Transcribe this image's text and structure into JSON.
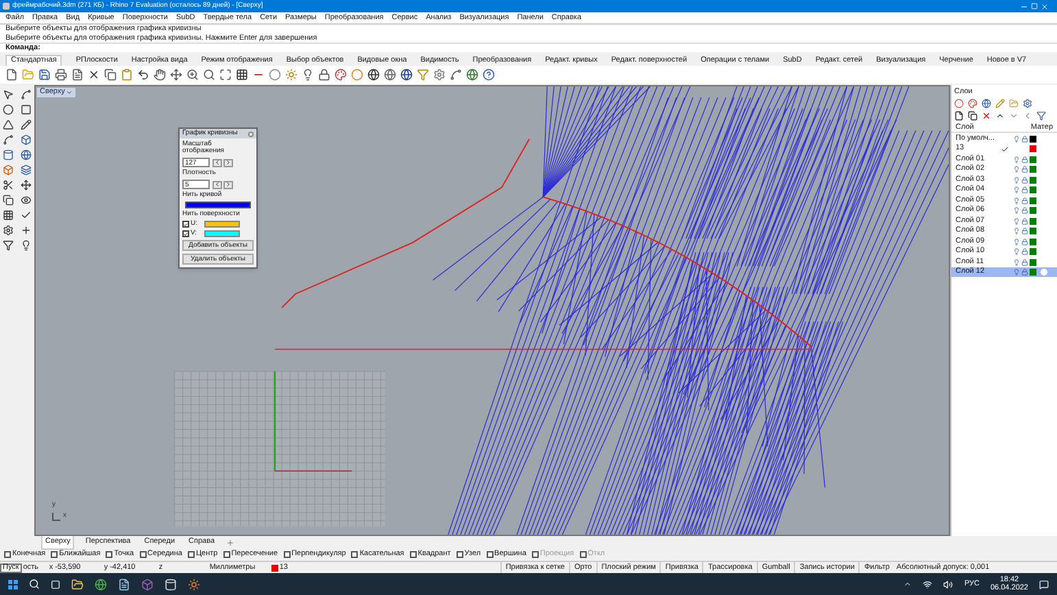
{
  "window": {
    "title": "фреймрабочий.3dm (271 КБ) - Rhino 7 Evaluation (осталось 89 дней) - [Сверху]"
  },
  "menu": [
    "Файл",
    "Правка",
    "Вид",
    "Кривые",
    "Поверхности",
    "SubD",
    "Твердые тела",
    "Сети",
    "Размеры",
    "Преобразования",
    "Сервис",
    "Анализ",
    "Визуализация",
    "Панели",
    "Справка"
  ],
  "command_history": [
    "Выберите объекты для отображения графика кривизны",
    "Выберите объекты для отображения графика кривизны. Нажмите Enter для завершения"
  ],
  "command_prompt": "Команда:",
  "toolbar_tabs": [
    {
      "label": "Стандартная",
      "selected": true
    },
    {
      "label": "РПлоскости",
      "selected": false
    },
    {
      "label": "Настройка вида",
      "selected": false
    },
    {
      "label": "Режим отображения",
      "selected": false
    },
    {
      "label": "Выбор объектов",
      "selected": false
    },
    {
      "label": "Видовые окна",
      "selected": false
    },
    {
      "label": "Видимость",
      "selected": false
    },
    {
      "label": "Преобразования",
      "selected": false
    },
    {
      "label": "Редакт. кривых",
      "selected": false
    },
    {
      "label": "Редакт. поверхностей",
      "selected": false
    },
    {
      "label": "Операции с телами",
      "selected": false
    },
    {
      "label": "SubD",
      "selected": false
    },
    {
      "label": "Редакт. сетей",
      "selected": false
    },
    {
      "label": "Визуализация",
      "selected": false
    },
    {
      "label": "Черчение",
      "selected": false
    },
    {
      "label": "Новое в V7",
      "selected": false
    }
  ],
  "viewport": {
    "title": "Сверху",
    "axis_labels": [
      "y",
      "x"
    ]
  },
  "curvature_dialog": {
    "title": "График кривизны",
    "scale_label": "Масштаб отображения",
    "scale_value": "127",
    "density_label": "Плотность",
    "density_value": "5",
    "curve_hair_label": "Нить кривой",
    "surface_hair_label": "Нить поверхности",
    "surface_hairs": [
      {
        "label": "U:",
        "checked": true,
        "color": "#ffc000"
      },
      {
        "label": "V:",
        "checked": true,
        "color": "#00ffff"
      }
    ],
    "buttons": [
      "Добавить объекты",
      "Удалить объекты"
    ]
  },
  "layers_panel": {
    "title": "Слои",
    "columns": [
      "Слой",
      "Матер"
    ],
    "layers": [
      {
        "name": "По умолч...",
        "current": false,
        "selected": false,
        "color": "#000000"
      },
      {
        "name": "13",
        "current": true,
        "selected": false,
        "color": "#e00000"
      },
      {
        "name": "Слой 01",
        "current": false,
        "selected": false,
        "color": "#008000"
      },
      {
        "name": "Слой 02",
        "current": false,
        "selected": false,
        "color": "#008000"
      },
      {
        "name": "Слой 03",
        "current": false,
        "selected": false,
        "color": "#008000"
      },
      {
        "name": "Слой 04",
        "current": false,
        "selected": false,
        "color": "#008000"
      },
      {
        "name": "Слой 05",
        "current": false,
        "selected": false,
        "color": "#008000"
      },
      {
        "name": "Слой 06",
        "current": false,
        "selected": false,
        "color": "#008000"
      },
      {
        "name": "Слой 07",
        "current": false,
        "selected": false,
        "color": "#008000"
      },
      {
        "name": "Слой 08",
        "current": false,
        "selected": false,
        "color": "#008000"
      },
      {
        "name": "Слой 09",
        "current": false,
        "selected": false,
        "color": "#008000"
      },
      {
        "name": "Слой 10",
        "current": false,
        "selected": false,
        "color": "#008000"
      },
      {
        "name": "Слой 11",
        "current": false,
        "selected": false,
        "color": "#008000"
      },
      {
        "name": "Слой 12",
        "current": false,
        "selected": true,
        "color": "#008000"
      }
    ]
  },
  "viewport_tabs": [
    {
      "label": "Сверху",
      "selected": true
    },
    {
      "label": "Перспектива",
      "selected": false
    },
    {
      "label": "Спереди",
      "selected": false
    },
    {
      "label": "Справа",
      "selected": false
    }
  ],
  "osnaps": [
    {
      "label": "Конечная",
      "checked": false,
      "disabled": false
    },
    {
      "label": "Ближайшая",
      "checked": false,
      "disabled": false
    },
    {
      "label": "Точка",
      "checked": false,
      "disabled": false
    },
    {
      "label": "Середина",
      "checked": false,
      "disabled": false
    },
    {
      "label": "Центр",
      "checked": false,
      "disabled": false
    },
    {
      "label": "Пересечение",
      "checked": false,
      "disabled": false
    },
    {
      "label": "Перпендикуляр",
      "checked": false,
      "disabled": false
    },
    {
      "label": "Касательная",
      "checked": false,
      "disabled": false
    },
    {
      "label": "Квадрант",
      "checked": false,
      "disabled": false
    },
    {
      "label": "Узел",
      "checked": false,
      "disabled": false
    },
    {
      "label": "Вершина",
      "checked": false,
      "disabled": false
    },
    {
      "label": "Проекция",
      "checked": false,
      "disabled": true
    },
    {
      "label": "Откл",
      "checked": false,
      "disabled": true
    }
  ],
  "status_bar": {
    "tooltip": "Пуск",
    "cplane": "ость",
    "x": "x -53,590",
    "y": "y -42,410",
    "z": "z",
    "units": "Миллиметры",
    "layer": "13",
    "toggles": [
      "Привязка к сетке",
      "Орто",
      "Плоский режим",
      "Привязка",
      "Трассировка",
      "Gumball",
      "Запись истории",
      "Фильтр"
    ],
    "tolerance": "Абсолютный допуск: 0,001"
  },
  "taskbar": {
    "language": "РУС",
    "time": "18:42",
    "date": "06.04.2022"
  }
}
